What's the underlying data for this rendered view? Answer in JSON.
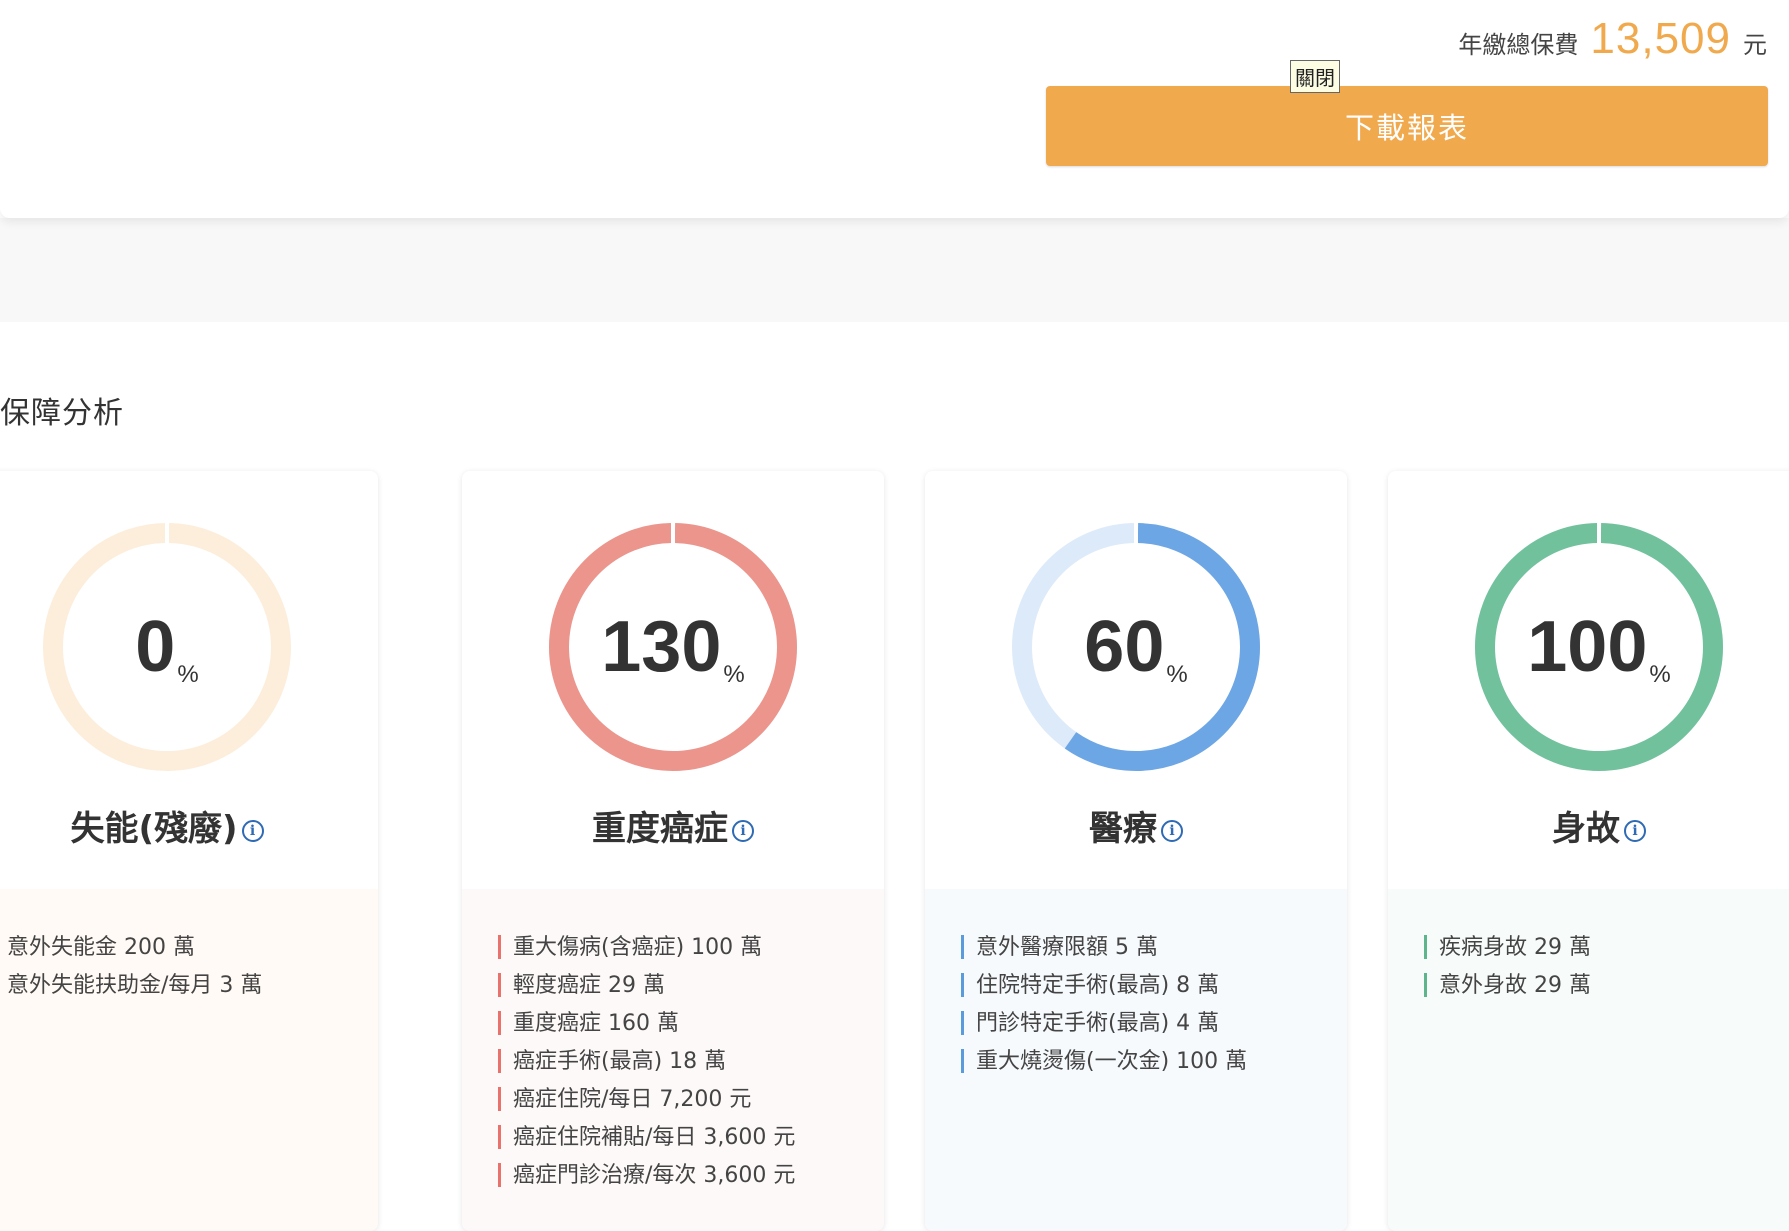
{
  "header": {
    "premium_label": "年繳總保費",
    "premium_amount": "13,509",
    "premium_unit": "元",
    "close_tip": "關閉",
    "download_label": "下載報表"
  },
  "section_title": "保障分析",
  "cards": [
    {
      "percent_value": 0,
      "percent": "0",
      "percent_sign": "%",
      "title": "失能(殘廢)",
      "info_icon": "info-icon",
      "ring_color": "#fdeedb",
      "track_color": "#fdeedb",
      "bottom_bg": "#fffaf5",
      "bar_color": "#f0a94d",
      "items": [
        "意外失能金 200 萬",
        "意外失能扶助金/每月 3 萬"
      ]
    },
    {
      "percent_value": 130,
      "percent": "130",
      "percent_sign": "%",
      "title": "重度癌症",
      "info_icon": "info-icon",
      "ring_color": "#eb958c",
      "track_color": "#fbe3e0",
      "bottom_bg": "#fdf9f8",
      "bar_color": "#e9736c",
      "items": [
        "重大傷病(含癌症) 100 萬",
        "輕度癌症 29 萬",
        "重度癌症 160 萬",
        "癌症手術(最高) 18 萬",
        "癌症住院/每日 7,200 元",
        "癌症住院補貼/每日 3,600 元",
        "癌症門診治療/每次 3,600 元"
      ]
    },
    {
      "percent_value": 60,
      "percent": "60",
      "percent_sign": "%",
      "title": "醫療",
      "info_icon": "info-icon",
      "ring_color": "#6da6e4",
      "track_color": "#ddeaf9",
      "bottom_bg": "#f7fafd",
      "bar_color": "#5b9bdc",
      "items": [
        "意外醫療限額 5 萬",
        "住院特定手術(最高) 8 萬",
        "門診特定手術(最高) 4 萬",
        "重大燒燙傷(一次金) 100 萬"
      ]
    },
    {
      "percent_value": 100,
      "percent": "100",
      "percent_sign": "%",
      "title": "身故",
      "info_icon": "info-icon",
      "ring_color": "#72c19d",
      "track_color": "#dff2e8",
      "bottom_bg": "#f7fbf9",
      "bar_color": "#5db58c",
      "items": [
        "疾病身故 29 萬",
        "意外身故 29 萬"
      ]
    }
  ]
}
